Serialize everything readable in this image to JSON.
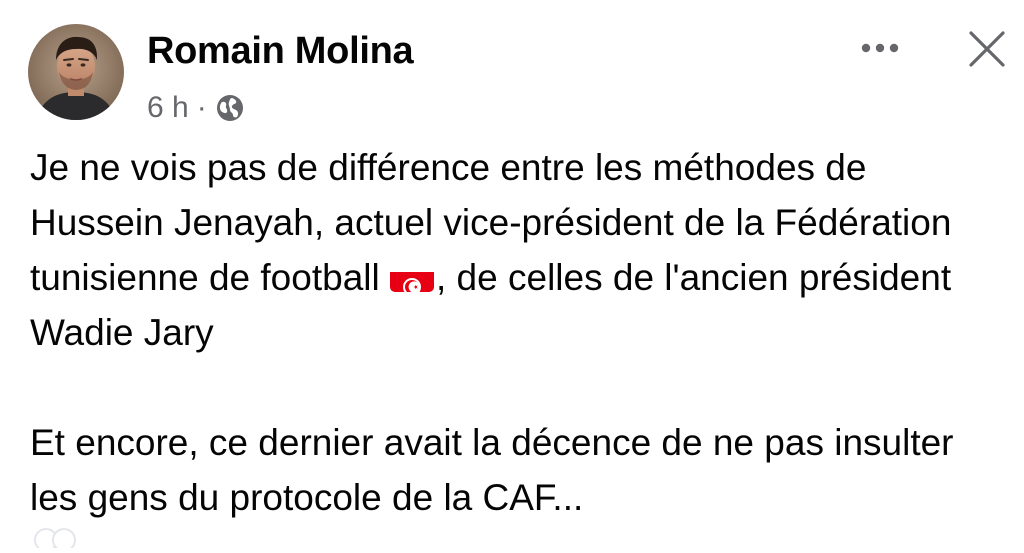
{
  "post": {
    "author": "Romain Molina",
    "time": "6 h",
    "separator": "·",
    "privacy_icon": "globe-icon",
    "more_icon": "more-dots-icon",
    "close_icon": "close-icon",
    "paragraph1_before_flag": "Je ne vois pas de différence entre les méthodes de Hussein Jenayah, actuel vice-président de la Fédération tunisienne de football ",
    "flag_icon": "tunisia-flag-icon",
    "paragraph1_after_flag": ", de celles de l'ancien président Wadie Jary",
    "paragraph2": "Et encore, ce dernier avait la décence de ne pas insulter les gens du protocole de la CAF..."
  },
  "colors": {
    "text": "#050505",
    "secondary_text": "#65676b",
    "flag_red": "#e70013"
  }
}
